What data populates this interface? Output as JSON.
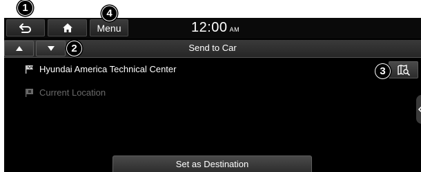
{
  "header": {
    "clock_time": "12:00",
    "clock_ampm": "AM",
    "menu_label": "Menu"
  },
  "titlebar": {
    "title": "Send to Car"
  },
  "list": [
    {
      "label": "Hyundai America Technical Center",
      "enabled": true
    },
    {
      "label": "Current Location",
      "enabled": false
    }
  ],
  "footer": {
    "action_label": "Set as Destination"
  },
  "callouts": [
    "1",
    "2",
    "3",
    "4"
  ],
  "icons": {
    "back": "back-arrow-icon",
    "home": "home-icon",
    "up": "up-arrow-icon",
    "down": "down-arrow-icon",
    "flag": "flag-icon",
    "map_search": "map-search-icon",
    "side_tab": "chevron-left-icon"
  },
  "colors": {
    "screen_bg": "#000000",
    "text": "#ffffff",
    "disabled_text": "#6a6a6a"
  }
}
